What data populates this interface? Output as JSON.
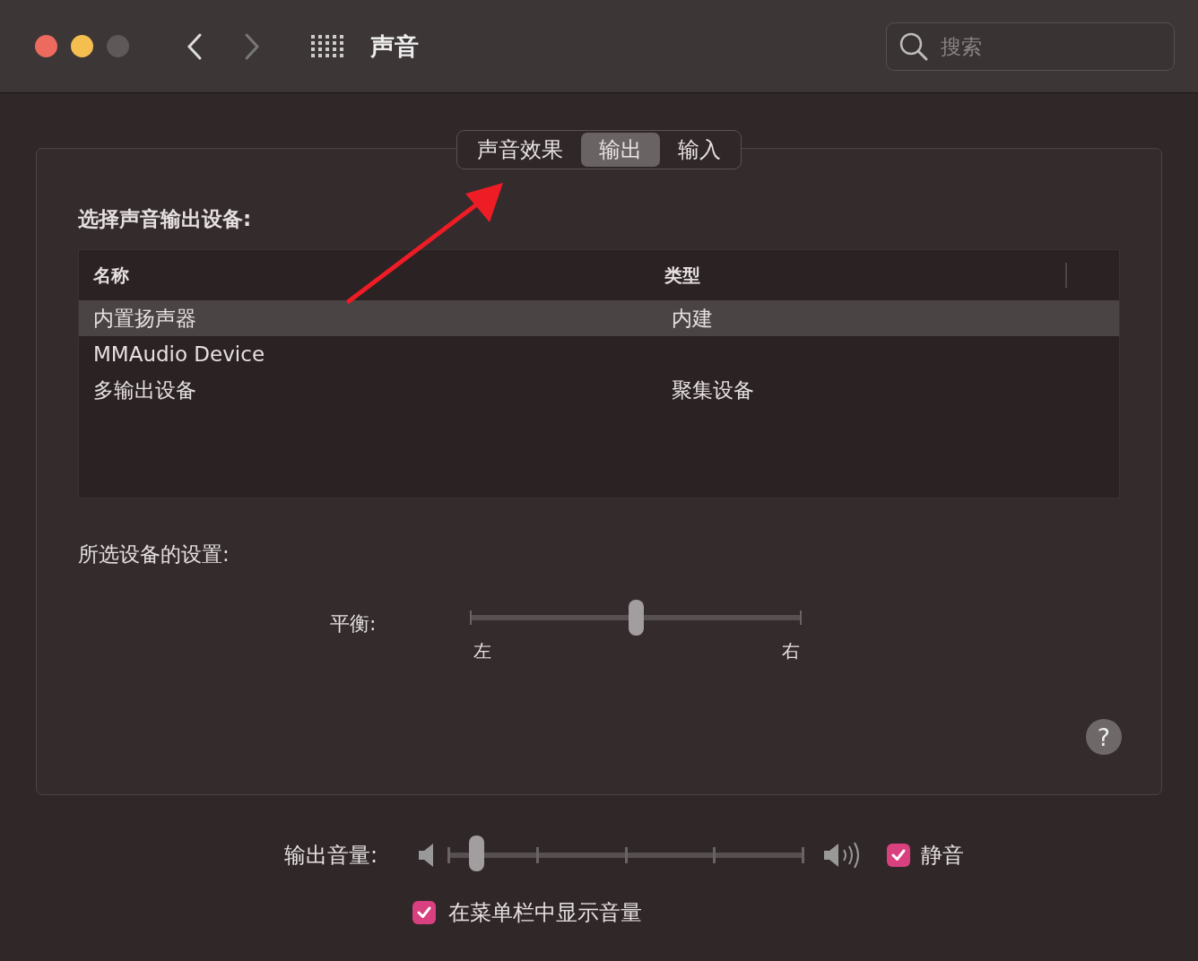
{
  "window": {
    "title": "声音"
  },
  "search": {
    "placeholder": "搜索"
  },
  "tabs": [
    {
      "label": "声音效果",
      "selected": false
    },
    {
      "label": "输出",
      "selected": true
    },
    {
      "label": "输入",
      "selected": false
    }
  ],
  "device_section": {
    "heading": "选择声音输出设备:",
    "columns": [
      "名称",
      "类型"
    ],
    "rows": [
      {
        "name": "内置扬声器",
        "type": "内建",
        "selected": true
      },
      {
        "name": "MMAudio Device",
        "selected": false
      },
      {
        "name": "多输出设备",
        "type": "聚集设备",
        "selected": false
      }
    ]
  },
  "settings": {
    "heading": "所选设备的设置:",
    "balance": {
      "label": "平衡:",
      "level": 0.5,
      "left_label": "左",
      "right_label": "右"
    }
  },
  "help_button": "?",
  "volume": {
    "label": "输出音量:",
    "level": 0.08,
    "mute": {
      "label": "静音",
      "checked": true
    }
  },
  "show_in_menu_bar": {
    "label": "在菜单栏中显示音量",
    "checked": true
  }
}
